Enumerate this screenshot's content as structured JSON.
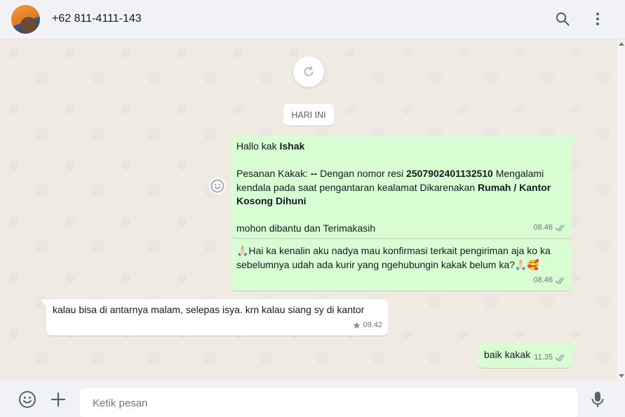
{
  "header": {
    "contact_name": "+62 811-4111-143",
    "search_icon": "search-icon",
    "menu_icon": "kebab-menu-icon"
  },
  "chat": {
    "reload_icon": "refresh-icon",
    "date_label": "HARI INI",
    "messages": [
      {
        "direction": "out",
        "greeting": "Hallo kak ",
        "greeting_name": "Ishak",
        "line2_a": "Pesanan Kakak: ",
        "line2_b": "--",
        "line2_c": " Dengan nomor resi ",
        "line2_d": "2507902401132510",
        "line2_e": " Mengalami",
        "line3_a": "kendala pada saat pengantaran kealamat Dikarenakan ",
        "line3_b": "Rumah / Kantor",
        "line4": "Kosong Dihuni",
        "line5": " mohon dibantu dan Terimakasih",
        "time": "08.46",
        "status": "double-check-icon"
      },
      {
        "direction": "out",
        "line1": "🙏🏻Hai ka kenalin aku nadya mau konfirmasi terkait pengiriman aja ko ka",
        "line2": "sebelumnya udah ada kurir yang ngehubungin kakak belum ka?🙏🏻🥰",
        "time": "08.46",
        "status": "double-check-icon"
      },
      {
        "direction": "in",
        "text": "kalau bisa di antarnya   malam, selepas isya. krn kalau siang sy di kantor",
        "time": "09.42",
        "starred": true
      },
      {
        "direction": "out",
        "text": "baik kakak",
        "time": "11.35",
        "status": "double-check-icon"
      }
    ]
  },
  "footer": {
    "emoji_icon": "emoji-icon",
    "attach_icon": "plus-icon",
    "input_placeholder": "Ketik pesan",
    "mic_icon": "microphone-icon"
  },
  "colors": {
    "outgoing_bubble": "#d9fdd3",
    "incoming_bubble": "#ffffff",
    "chat_bg": "#efeae2",
    "header_bg": "#f0f2f5",
    "tick": "#8696a0"
  }
}
